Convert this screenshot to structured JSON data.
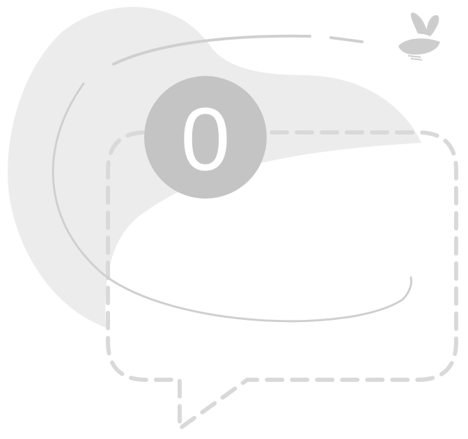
{
  "empty_state": {
    "count": "0"
  },
  "colors": {
    "blob": "#ececec",
    "badge": "#c4c4c4",
    "badge_text": "#ffffff",
    "dashed_bubble": "#d9d9d9",
    "orbit_line": "#cfcfcf",
    "butterfly": "#cdcdcd"
  },
  "icons": {
    "butterfly": "butterfly-icon",
    "speech_bubble": "speech-bubble-icon",
    "count_badge": "count-badge"
  }
}
